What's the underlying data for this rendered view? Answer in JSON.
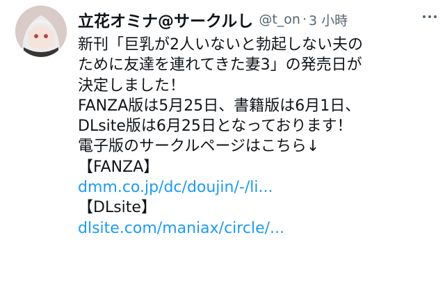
{
  "post": {
    "author_name": "立花オミナ@サークルし",
    "handle": "@t_on",
    "separator": "·",
    "time": "3 小時",
    "lines": [
      "新刊「巨乳が2人いないと勃起しない夫の",
      "ために友達を連れてきた妻3」の発売日が",
      "決定しました！",
      "FANZA版は5月25日、書籍版は6月1日、",
      "DLsite版は6月25日となっております！",
      "電子版のサークルページはこちら↓",
      "【FANZA】"
    ],
    "link_fanza": "dmm.co.jp/dc/doujin/-/li...",
    "label_dlsite": "【DLsite】",
    "link_dlsite": "dlsite.com/maniax/circle/..."
  },
  "icons": {
    "more": "more-horizontal-icon",
    "avatar": "avatar-image"
  },
  "colors": {
    "text": "#0f1419",
    "muted": "#536471",
    "link": "#1d9bf0"
  }
}
